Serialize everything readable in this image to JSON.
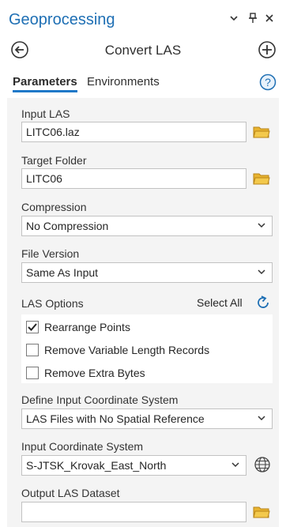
{
  "pane": {
    "title": "Geoprocessing",
    "controls": {
      "options_glyph": "⌄",
      "pin_glyph": "📌",
      "close_glyph": "✕"
    }
  },
  "tool": {
    "title": "Convert LAS",
    "back_icon": "back-arrow-circle",
    "add_icon": "plus-circle"
  },
  "tabs": [
    {
      "label": "Parameters",
      "active": true
    },
    {
      "label": "Environments",
      "active": false
    }
  ],
  "params": {
    "input_las": {
      "label": "Input LAS",
      "value": "LITC06.laz"
    },
    "target_folder": {
      "label": "Target Folder",
      "value": "LITC06"
    },
    "compression": {
      "label": "Compression",
      "value": "No Compression"
    },
    "file_version": {
      "label": "File Version",
      "value": "Same As Input"
    },
    "las_options": {
      "label": "LAS Options",
      "select_all": "Select All",
      "items": [
        {
          "label": "Rearrange Points",
          "checked": true
        },
        {
          "label": "Remove Variable Length Records",
          "checked": false
        },
        {
          "label": "Remove Extra Bytes",
          "checked": false
        }
      ]
    },
    "define_cs": {
      "label": "Define Input Coordinate System",
      "value": "LAS Files with No Spatial Reference"
    },
    "input_cs": {
      "label": "Input Coordinate System",
      "value": "S-JTSK_Krovak_East_North"
    },
    "output_las": {
      "label": "Output LAS Dataset",
      "value": ""
    }
  },
  "colors": {
    "accent": "#1e6fb4",
    "panel_bg": "#f4f4f4",
    "folder": "#e8b330",
    "tab_underline": "#1f78c8"
  }
}
